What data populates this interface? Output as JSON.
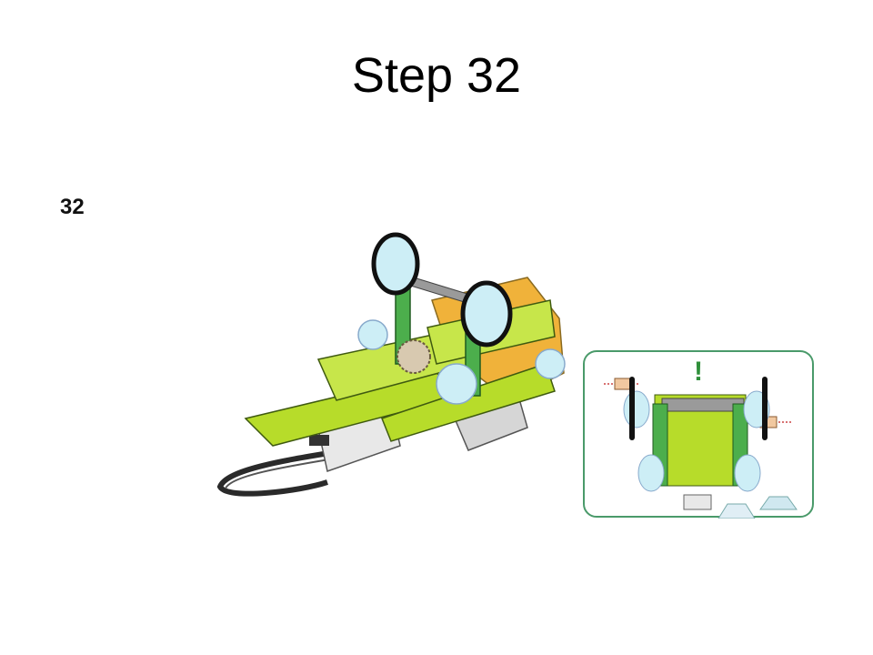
{
  "slide": {
    "title": "Step 32",
    "step_number": "32",
    "callout": {
      "alert_mark": "!"
    }
  },
  "colors": {
    "lime": "#b7dc2a",
    "green": "#4cae4c",
    "orange": "#f0b23a",
    "gray": "#9a9a9a",
    "wheel_tire": "#111111",
    "wheel_hub": "#bfe6f0",
    "callout_border": "#4a9a6a",
    "alert": "#2f8f3a"
  }
}
